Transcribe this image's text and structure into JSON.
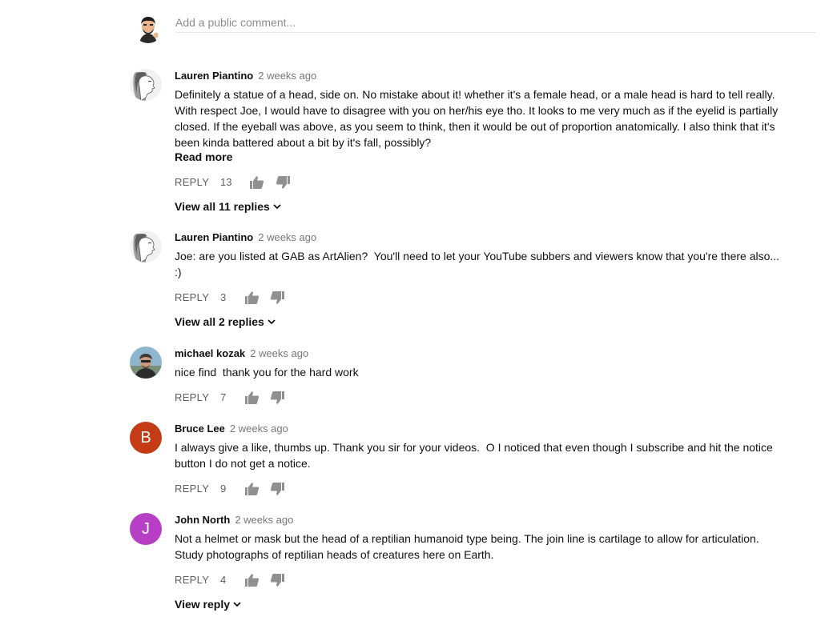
{
  "add_comment": {
    "placeholder": "Add a public comment..."
  },
  "comments": [
    {
      "author": "Lauren Piantino",
      "time": "2 weeks ago",
      "avatar_icon": "portrait-sketch-avatar",
      "text": "Definitely a statue of a head, side on. No mistake about it! whether it's a female head, or a male head is hard to tell really. With respect Joe, I would have to disagree with you on her/his eye tho. It looks to me very much as if the eyelid is partially closed. If the eyeball was above, as you seem to think, then it would be out of proportion anatomically. I also think that it's been kinda battered about a bit by it's fall, possibly?",
      "read_more": "Read more",
      "reply_label": "REPLY",
      "likes": "13",
      "view_replies": "View all 11 replies"
    },
    {
      "author": "Lauren Piantino",
      "time": "2 weeks ago",
      "avatar_icon": "portrait-sketch-avatar",
      "text": "Joe: are you listed at GAB as ArtAlien?  You'll need to let your YouTube subbers and viewers know that you're there also... :)",
      "reply_label": "REPLY",
      "likes": "3",
      "view_replies": "View all 2 replies"
    },
    {
      "author": "michael kozak",
      "time": "2 weeks ago",
      "avatar_icon": "photo-avatar",
      "text": "nice find  thank you for the hard work",
      "reply_label": "REPLY",
      "likes": "7"
    },
    {
      "author": "Bruce Lee",
      "time": "2 weeks ago",
      "avatar_letter": "B",
      "avatar_color": "#c43c16",
      "text": "I always give a like, thumbs up. Thank you sir for your videos.  O I noticed that even though I subscribe and hit the notice button I do not get a notice.",
      "reply_label": "REPLY",
      "likes": "9"
    },
    {
      "author": "John North",
      "time": "2 weeks ago",
      "avatar_letter": "J",
      "avatar_color": "#b63fc6",
      "text": "Not a helmet or mask but the head of a reptilian humanoid type being. The join line is cartilage to allow for articulation. Study photographs of reptilian heads of creatures here on Earth.",
      "reply_label": "REPLY",
      "likes": "4",
      "view_replies": "View reply"
    }
  ]
}
